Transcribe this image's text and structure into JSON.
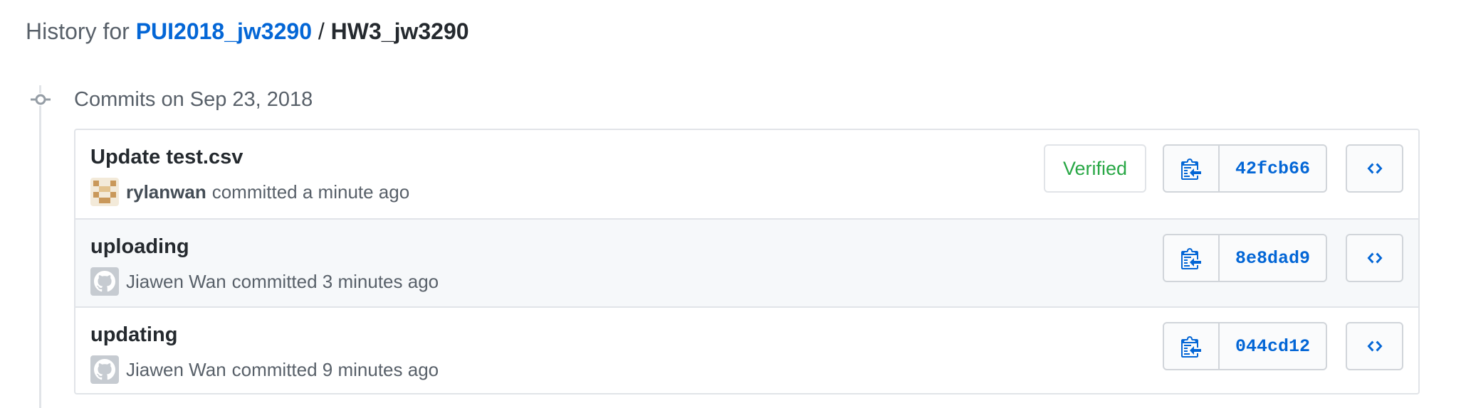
{
  "header": {
    "prefix": "History for",
    "repo": "PUI2018_jw3290",
    "separator": "/",
    "directory": "HW3_jw3290"
  },
  "date_group": {
    "label": "Commits on Sep 23, 2018"
  },
  "commits": [
    {
      "title": "Update test.csv",
      "author": "rylanwan",
      "action": "committed a minute ago",
      "verified_label": "Verified",
      "sha": "42fcb66",
      "avatar_icon": "identicon-avatar"
    },
    {
      "title": "uploading",
      "author": "Jiawen Wan",
      "action": "committed 3 minutes ago",
      "sha": "8e8dad9",
      "avatar_icon": "github-octocat-avatar"
    },
    {
      "title": "updating",
      "author": "Jiawen Wan",
      "action": "committed 9 minutes ago",
      "sha": "044cd12",
      "avatar_icon": "github-octocat-avatar"
    }
  ],
  "icons": {
    "copy": "clippy-icon",
    "browse": "code-icon",
    "timeline": "commit-node-icon"
  },
  "colors": {
    "link": "#0366d6",
    "verified": "#28a745",
    "muted": "#586069",
    "border": "#e1e4e8",
    "row_alt": "#f6f8fa"
  }
}
